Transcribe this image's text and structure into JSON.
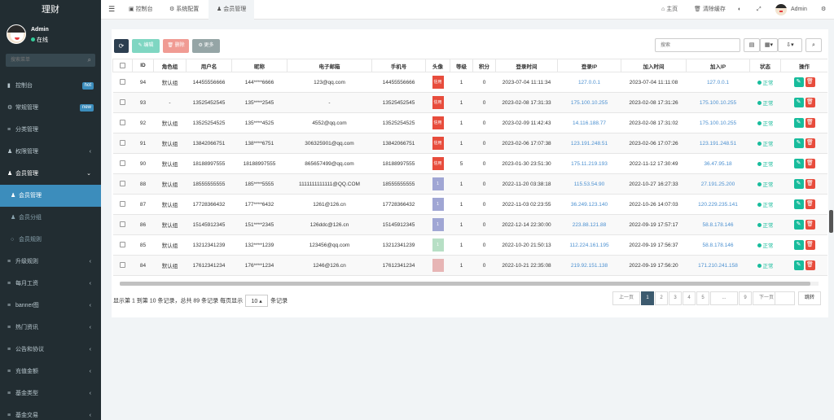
{
  "app": {
    "logo": "理财",
    "user": "Admin",
    "status": "在线"
  },
  "sidebar": {
    "search_placeholder": "搜索菜单",
    "items": [
      {
        "icon": "▮",
        "label": "控制台",
        "badge": "hot",
        "badge_color": "#3c8dbc"
      },
      {
        "icon": "⚙",
        "label": "常规管理",
        "badge": "new",
        "badge_color": "#3c8dbc"
      },
      {
        "icon": "≡",
        "label": "分类管理"
      },
      {
        "icon": "♟",
        "label": "权限管理",
        "chev": "‹"
      },
      {
        "icon": "♟",
        "label": "会员管理",
        "chev": "⌄"
      },
      {
        "icon": "♟",
        "label": "会员管理",
        "sub": true
      },
      {
        "icon": "♟",
        "label": "会员分组",
        "sub": true
      },
      {
        "icon": "○",
        "label": "会员规则",
        "sub": true
      },
      {
        "icon": "≡",
        "label": "升级规则",
        "chev": "‹"
      },
      {
        "icon": "≡",
        "label": "每月工资",
        "chev": "‹"
      },
      {
        "icon": "≡",
        "label": "banner图",
        "chev": "‹"
      },
      {
        "icon": "≡",
        "label": "热门资讯",
        "chev": "‹"
      },
      {
        "icon": "≡",
        "label": "公告和协议",
        "chev": "‹"
      },
      {
        "icon": "≡",
        "label": "充值金额",
        "chev": "‹"
      },
      {
        "icon": "≡",
        "label": "基金类型",
        "chev": "‹"
      },
      {
        "icon": "≡",
        "label": "基金交易",
        "chev": "‹"
      }
    ]
  },
  "topbar": {
    "tabs": [
      {
        "icon": "▣",
        "label": "控制台"
      },
      {
        "icon": "⚙",
        "label": "系统配置"
      },
      {
        "icon": "♟",
        "label": "会员管理"
      }
    ],
    "right": {
      "home": "主页",
      "clear": "清除缓存",
      "user": "Admin"
    }
  },
  "toolbar": {
    "refresh": "⟳",
    "edit": "✎ 编辑",
    "delete": "🗑 删除",
    "more": "⚙ 更多",
    "search_placeholder": "搜索",
    "colors": {
      "refresh": "#2c3e50",
      "edit": "#7fd6c2",
      "delete": "#f09b93",
      "more": "#95a5a6"
    }
  },
  "table": {
    "headers": [
      "",
      "ID",
      "角色组",
      "用户名",
      "昵称",
      "电子邮箱",
      "手机号",
      "头像",
      "等级",
      "积分",
      "登录时间",
      "登录IP",
      "加入时间",
      "加入IP",
      "状态",
      "操作"
    ],
    "rows": [
      {
        "id": "94",
        "group": "默认组",
        "username": "14455556666",
        "nick": "144****6666",
        "email": "123@qq.com",
        "phone": "14455556666",
        "avatar": "信用",
        "avc": "#e74c3c",
        "level": "1",
        "score": "0",
        "login": "2023-07-04 11:11:34",
        "loginip": "127.0.0.1",
        "join": "2023-07-04 11:11:08",
        "joinip": "127.0.0.1",
        "status": "正常"
      },
      {
        "id": "93",
        "group": "-",
        "username": "13525452545",
        "nick": "135****2545",
        "email": "-",
        "phone": "13525452545",
        "avatar": "信用",
        "avc": "#e74c3c",
        "level": "1",
        "score": "0",
        "login": "2023-02-08 17:31:33",
        "loginip": "175.100.10.255",
        "join": "2023-02-08 17:31:26",
        "joinip": "175.100.10.255",
        "status": "正常"
      },
      {
        "id": "92",
        "group": "默认组",
        "username": "13525254525",
        "nick": "135****4525",
        "email": "4552@qq.com",
        "phone": "13525254525",
        "avatar": "信用",
        "avc": "#e74c3c",
        "level": "1",
        "score": "0",
        "login": "2023-02-09 11:42:43",
        "loginip": "14.116.188.77",
        "join": "2023-02-08 17:31:02",
        "joinip": "175.100.10.255",
        "status": "正常"
      },
      {
        "id": "91",
        "group": "默认组",
        "username": "13842066751",
        "nick": "138****6751",
        "email": "306325901@qq.com",
        "phone": "13842066751",
        "avatar": "信用",
        "avc": "#e74c3c",
        "level": "1",
        "score": "0",
        "login": "2023-02-06 17:07:38",
        "loginip": "123.191.248.51",
        "join": "2023-02-06 17:07:26",
        "joinip": "123.191.248.51",
        "status": "正常"
      },
      {
        "id": "90",
        "group": "默认组",
        "username": "18188997555",
        "nick": "18188997555",
        "email": "865657499@qq.com",
        "phone": "18188997555",
        "avatar": "信用",
        "avc": "#e74c3c",
        "level": "5",
        "score": "0",
        "login": "2023-01-30 23:51:30",
        "loginip": "175.11.219.193",
        "join": "2022-11-12 17:30:49",
        "joinip": "36.47.95.18",
        "status": "正常"
      },
      {
        "id": "88",
        "group": "默认组",
        "username": "18555555555",
        "nick": "185****5555",
        "email": "1111111111111@QQ.COM",
        "phone": "18555555555",
        "avatar": "1",
        "avc": "#a0a6d4",
        "level": "1",
        "score": "0",
        "login": "2022-11-20 03:38:18",
        "loginip": "115.53.54.90",
        "join": "2022-10-27 16:27:33",
        "joinip": "27.191.25.200",
        "status": "正常"
      },
      {
        "id": "87",
        "group": "默认组",
        "username": "17728366432",
        "nick": "177****6432",
        "email": "1261@126.cn",
        "phone": "17728366432",
        "avatar": "1",
        "avc": "#a0a6d4",
        "level": "1",
        "score": "0",
        "login": "2022-11-03 02:23:55",
        "loginip": "36.249.123.140",
        "join": "2022-10-26 14:07:03",
        "joinip": "120.229.235.141",
        "status": "正常"
      },
      {
        "id": "86",
        "group": "默认组",
        "username": "15145912345",
        "nick": "151****2345",
        "email": "126ddc@126.cn",
        "phone": "15145912345",
        "avatar": "1",
        "avc": "#a0a6d4",
        "level": "1",
        "score": "0",
        "login": "2022-12-14 22:30:00",
        "loginip": "223.88.121.88",
        "join": "2022-09-19 17:57:17",
        "joinip": "58.8.178.146",
        "status": "正常"
      },
      {
        "id": "85",
        "group": "默认组",
        "username": "13212341239",
        "nick": "132****1239",
        "email": "123456@qq.com",
        "phone": "13212341239",
        "avatar": "1",
        "avc": "#b7dfc5",
        "level": "1",
        "score": "0",
        "login": "2022-10-20 21:50:13",
        "loginip": "112.224.161.195",
        "join": "2022-09-19 17:56:37",
        "joinip": "58.8.178.146",
        "status": "正常"
      },
      {
        "id": "84",
        "group": "默认组",
        "username": "17612341234",
        "nick": "176****1234",
        "email": "1246@126.cn",
        "phone": "17612341234",
        "avatar": "",
        "avc": "#e7b5b5",
        "level": "1",
        "score": "0",
        "login": "2022-10-21 22:35:08",
        "loginip": "219.92.151.138",
        "join": "2022-09-19 17:56:20",
        "joinip": "171.210.241.158",
        "status": "正常"
      }
    ]
  },
  "footer": {
    "summary": "显示第 1 到第 10 条记录，总共 89 条记录 每页显示",
    "per_page": "10 ▴",
    "suffix": "条记录",
    "pagination": [
      "上一页",
      "1",
      "2",
      "3",
      "4",
      "5",
      "...",
      "9",
      "下一页"
    ],
    "jump": "跳转"
  }
}
